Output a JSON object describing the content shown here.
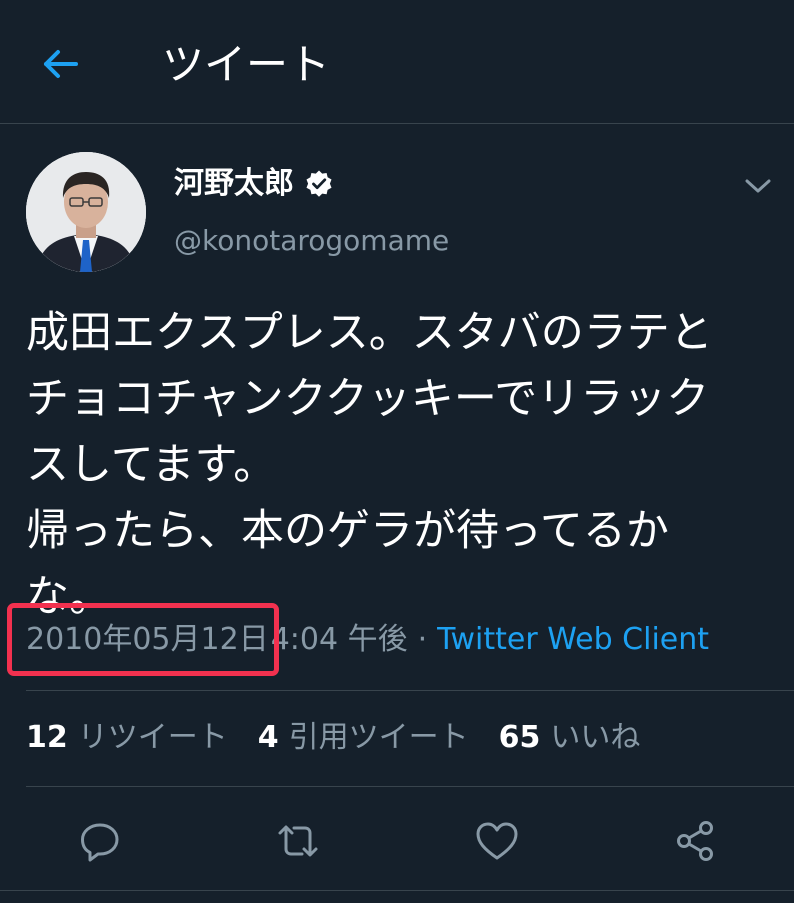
{
  "header": {
    "title": "ツイート",
    "back_icon": "arrow-left-icon"
  },
  "author": {
    "name": "河野太郎",
    "handle": "@konotarogomame",
    "verified": true
  },
  "tweet": {
    "text": "成田エクスプレス。スタバのラテと\nチョコチャンククッキーでリラック\nスしてます。\n帰ったら、本のゲラが待ってるか\nな。"
  },
  "meta": {
    "date": "2010年05月12日",
    "time": "4:04 午後",
    "separator": "·",
    "client": "Twitter Web Client"
  },
  "stats": {
    "retweets_count": "12",
    "retweets_label": "リツイート",
    "quotes_count": "4",
    "quotes_label": "引用ツイート",
    "likes_count": "65",
    "likes_label": "いいね"
  },
  "colors": {
    "background": "#15202b",
    "accent": "#1da1f2",
    "secondary_text": "#8899a6",
    "highlight": "#f2314f"
  }
}
